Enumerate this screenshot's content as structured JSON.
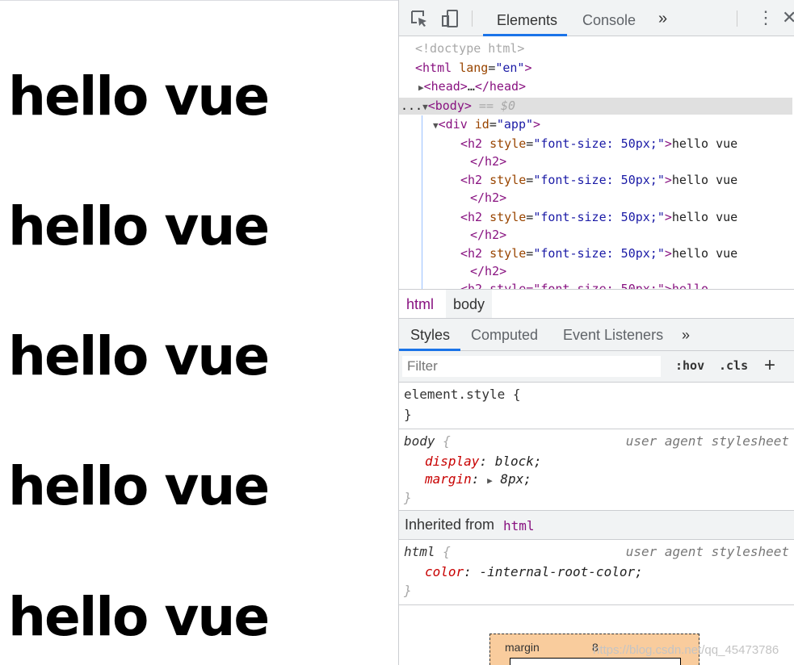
{
  "page": {
    "headings": [
      "hello vue",
      "hello vue",
      "hello vue",
      "hello vue",
      "hello vue"
    ]
  },
  "devtools": {
    "toolbar": {
      "inspect_icon": "inspect-element-icon",
      "device_icon": "device-toolbar-icon",
      "tabs": [
        "Elements",
        "Console"
      ],
      "more": "»",
      "kebab": "⋮",
      "close": "✕"
    },
    "dom": {
      "doctype": "<!doctype html>",
      "html_open_tag": "html",
      "html_attr": "lang",
      "html_attr_val": "\"en\"",
      "head_tag": "head",
      "head_ellipsis": "…",
      "body_tag": "body",
      "body_suffix": " == $0",
      "dots": "...",
      "div_tag": "div",
      "div_attr": "id",
      "div_attr_val": "\"app\"",
      "h2_tag": "h2",
      "h2_attr": "style",
      "h2_attr_val": "\"font-size: 50px;\"",
      "h2_text": "hello vue",
      "h2_close": "</h2>",
      "partial": "<h2 style=\"font-size: 50px;\">hello"
    },
    "breadcrumbs": [
      "html",
      "body"
    ],
    "subtabs": [
      "Styles",
      "Computed",
      "Event Listeners"
    ],
    "subtabs_more": "»",
    "filter": {
      "placeholder": "Filter",
      "hov": ":hov",
      "cls": ".cls",
      "plus": "+"
    },
    "rules": {
      "element_style_selector": "element.style {",
      "close_brace": "}",
      "body_selector": "body",
      "open_brace": "{",
      "ua_label": "user agent stylesheet",
      "body_props": [
        {
          "name": "display",
          "value": "block;"
        },
        {
          "name": "margin",
          "value": "8px;"
        }
      ],
      "inherited_label": "Inherited from",
      "inherited_tag": "html",
      "html_selector": "html",
      "html_props": [
        {
          "name": "color",
          "value": "-internal-root-color;"
        }
      ]
    },
    "box_model": {
      "label": "margin",
      "value": "8"
    },
    "watermark": "https://blog.csdn.net/qq_45473786"
  }
}
